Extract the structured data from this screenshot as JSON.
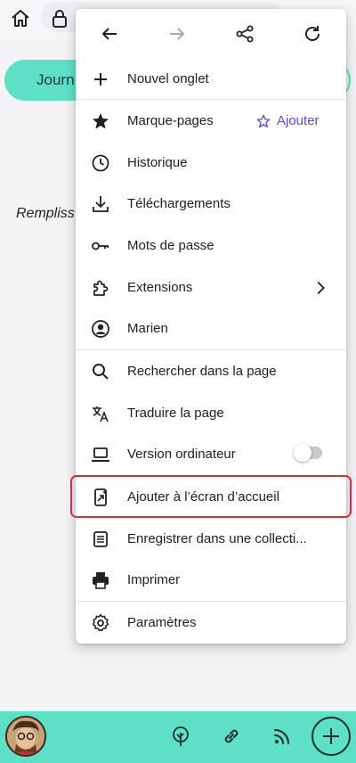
{
  "background": {
    "journal_label": "Journ",
    "filler_text": "Rempliss"
  },
  "menu": {
    "toolbar": {
      "icons": [
        "back-arrow-icon",
        "forward-arrow-icon",
        "share-icon",
        "reload-icon"
      ]
    },
    "items": [
      {
        "label": "Nouvel onglet",
        "icon": "plus-icon"
      },
      {
        "label": "Marque-pages",
        "icon": "star-filled-icon",
        "action_label": "Ajouter"
      },
      {
        "label": "Historique",
        "icon": "clock-icon"
      },
      {
        "label": "Téléchargements",
        "icon": "download-icon"
      },
      {
        "label": "Mots de passe",
        "icon": "key-icon"
      },
      {
        "label": "Extensions",
        "icon": "puzzle-icon"
      },
      {
        "label": "Marien",
        "icon": "account-icon"
      },
      {
        "label": "Rechercher dans la page",
        "icon": "search-icon"
      },
      {
        "label": "Traduire la page",
        "icon": "translate-icon"
      },
      {
        "label": "Version ordinateur",
        "icon": "laptop-icon",
        "toggle_on": false
      },
      {
        "label": "Ajouter à l’écran d’accueil",
        "icon": "add-to-home-icon"
      },
      {
        "label": "Enregistrer dans une collecti...",
        "icon": "collection-icon"
      },
      {
        "label": "Imprimer",
        "icon": "printer-icon"
      },
      {
        "label": "Paramètres",
        "icon": "gear-icon"
      }
    ]
  },
  "colors": {
    "accent_teal": "#5ee0c6",
    "link_purple": "#5b4bd1",
    "highlight_red": "#d2303a"
  }
}
